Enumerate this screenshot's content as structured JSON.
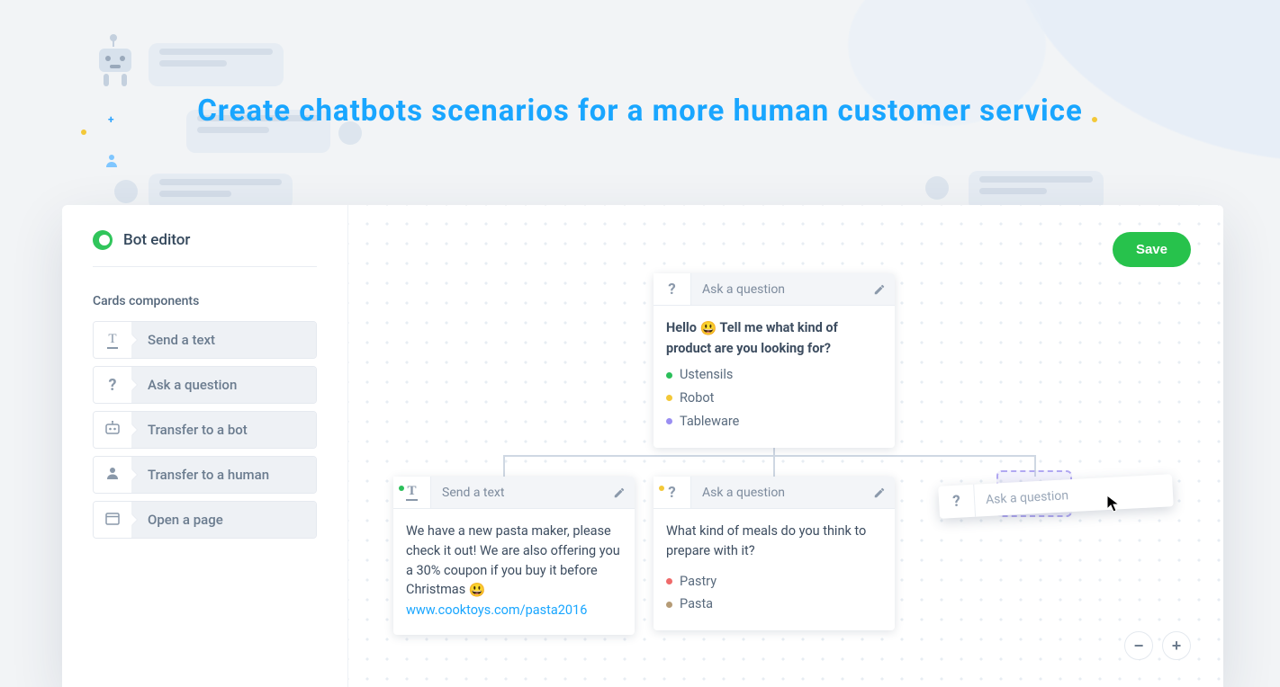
{
  "headline": "Create chatbots scenarios for a more human customer service",
  "sidebar": {
    "title": "Bot editor",
    "section": "Cards components",
    "components": [
      {
        "label": "Send a text",
        "icon": "text"
      },
      {
        "label": "Ask a question",
        "icon": "question"
      },
      {
        "label": "Transfer to a bot",
        "icon": "bot"
      },
      {
        "label": "Transfer to a human",
        "icon": "human"
      },
      {
        "label": "Open a page",
        "icon": "page"
      }
    ]
  },
  "canvas": {
    "save_label": "Save",
    "nodes": {
      "root": {
        "type_label": "Ask a question",
        "body_before": "Hello ",
        "body_after": " Tell me what kind of product are you looking for?",
        "emoji": "😃",
        "options": [
          {
            "label": "Ustensils",
            "color": "#2bbf5a"
          },
          {
            "label": "Robot",
            "color": "#f3c838"
          },
          {
            "label": "Tableware",
            "color": "#9a8ef2"
          }
        ]
      },
      "left": {
        "type_label": "Send a text",
        "status_color": "#2bbf5a",
        "body": "We have a new pasta maker, please check it out! We are also offering you a 30% coupon if you buy it before Christmas ",
        "emoji": "😃",
        "link": "www.cooktoys.com/pasta2016"
      },
      "mid": {
        "type_label": "Ask a question",
        "status_color": "#f3c838",
        "body": "What kind of meals do you think to prepare with it?",
        "options": [
          {
            "label": "Pastry",
            "color": "#ef6a6a"
          },
          {
            "label": "Pasta",
            "color": "#b59b76"
          }
        ]
      },
      "drag": {
        "type_label": "Ask a question"
      }
    },
    "zoom": {
      "minus": "−",
      "plus": "+"
    }
  }
}
